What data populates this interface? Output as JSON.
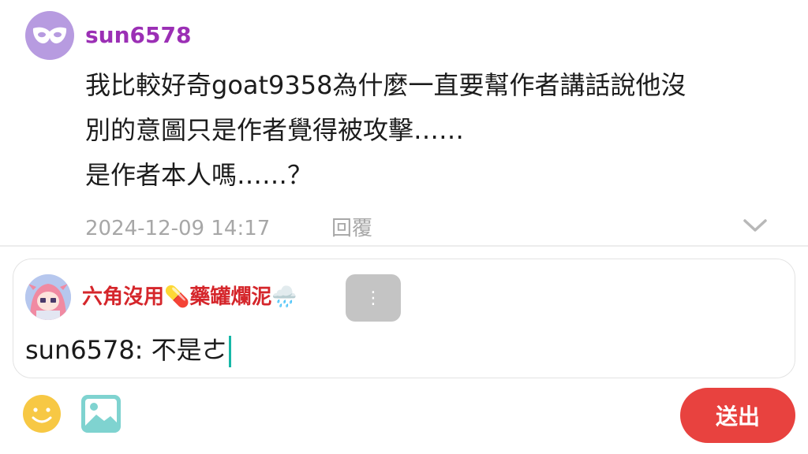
{
  "comment": {
    "username": "sun6578",
    "body_lines": [
      "我比較好奇goat9358為什麼一直要幫作者講話說他沒",
      "別的意圖只是作者覺得被攻擊……",
      "是作者本人嗎……？"
    ],
    "timestamp": "2024-12-09 14:17",
    "reply_label": "回覆",
    "avatar_icon": "mask-icon",
    "expand_icon": "chevron-down-icon"
  },
  "composer": {
    "reply_to_name": "六角沒用💊藥罐爛泥🌧️",
    "more_label": "⋮",
    "input_value": "sun6578: 不是ㄜ",
    "send_label": "送出",
    "emoji_icon": "emoji-icon",
    "image_icon": "image-icon"
  },
  "colors": {
    "username": "#9b2fb5",
    "reply_name": "#d5262b",
    "send": "#e8423f",
    "caret": "#17b7a7",
    "meta": "#a7a7a7"
  }
}
